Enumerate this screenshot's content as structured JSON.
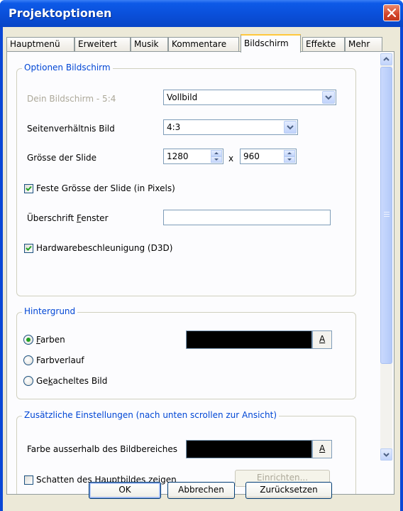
{
  "window": {
    "title": "Projektoptionen"
  },
  "tabs": [
    {
      "label": "Hauptmenü"
    },
    {
      "label": "Erweitert"
    },
    {
      "label": "Musik"
    },
    {
      "label": "Kommentare"
    },
    {
      "label": "Bildschirm",
      "active": true
    },
    {
      "label": "Effekte"
    },
    {
      "label": "Mehr"
    }
  ],
  "screen_options": {
    "legend": "Optionen Bildschirm",
    "screen_label": "Dein Bildschirm - 5:4",
    "screen_value": "Vollbild",
    "aspect_label": "Seitenverhältnis Bild",
    "aspect_value": "4:3",
    "size_label": "Grösse der Slide",
    "width_value": "1280",
    "times": "x",
    "height_value": "960",
    "fixed_size_label": "Feste Grösse der Slide (in Pixels)",
    "fixed_size_checked": true,
    "window_title_label_pre": "Überschrift ",
    "window_title_label_u": "F",
    "window_title_label_post": "enster",
    "window_title_value": "",
    "hw_accel_label": "Hardwarebeschleunigung (D3D)",
    "hw_accel_checked": true
  },
  "background": {
    "legend": "Hintergrund",
    "opt_colors_u": "F",
    "opt_colors_rest": "arben",
    "opt_gradient": "Farbverlauf",
    "opt_tiled_pre": "Ge",
    "opt_tiled_u": "k",
    "opt_tiled_post": "acheltes Bild",
    "selected": "Farben",
    "color": "#000000",
    "color_button": "A"
  },
  "additional": {
    "legend": "Zusätzliche Einstellungen (nach unten scrollen zur Ansicht)",
    "outside_color_label": "Farbe ausserhalb des Bildbereiches",
    "outside_color": "#000000",
    "color_button": "A",
    "shadow_label": "Schatten des Hauptbildes zeigen",
    "shadow_checked": false,
    "setup_button": "Einrichten..."
  },
  "buttons": {
    "ok": "OK",
    "cancel": "Abbrechen",
    "reset": "Zurücksetzen"
  }
}
